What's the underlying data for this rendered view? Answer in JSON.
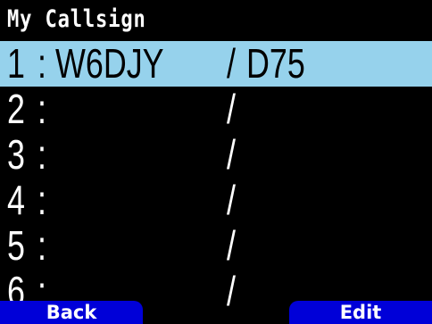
{
  "screen": {
    "title": "My Callsign"
  },
  "callsigns": [
    {
      "num": "1",
      "colon": ":",
      "call": "W6DJY",
      "slash": "/",
      "suffix": "D75",
      "selected": true
    },
    {
      "num": "2",
      "colon": ":",
      "call": "",
      "slash": "/",
      "suffix": "",
      "selected": false
    },
    {
      "num": "3",
      "colon": ":",
      "call": "",
      "slash": "/",
      "suffix": "",
      "selected": false
    },
    {
      "num": "4",
      "colon": ":",
      "call": "",
      "slash": "/",
      "suffix": "",
      "selected": false
    },
    {
      "num": "5",
      "colon": ":",
      "call": "",
      "slash": "/",
      "suffix": "",
      "selected": false
    },
    {
      "num": "6",
      "colon": ":",
      "call": "",
      "slash": "/",
      "suffix": "",
      "selected": false
    }
  ],
  "softkeys": {
    "left_label": "Back",
    "right_label": "Edit"
  },
  "colors": {
    "background": "#000000",
    "highlight": "#96d2ec",
    "softkey": "#0000d8",
    "text": "#ffffff"
  }
}
